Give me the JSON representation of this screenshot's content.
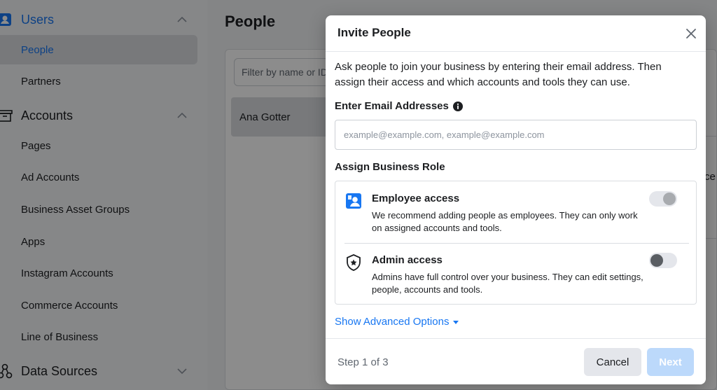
{
  "colors": {
    "accent": "#1877f2",
    "next_disabled": "#bcd9fb",
    "overlay": "rgba(0,0,0,0.45)"
  },
  "sidebar": {
    "sections": [
      {
        "label": "Users",
        "icon": "users-icon",
        "expanded": true,
        "active": true
      },
      {
        "label": "Accounts",
        "icon": "accounts-icon",
        "expanded": true,
        "active": false
      },
      {
        "label": "Data Sources",
        "icon": "data-sources-icon",
        "expanded": false,
        "active": false
      }
    ],
    "users_items": [
      {
        "label": "People",
        "selected": true
      },
      {
        "label": "Partners",
        "selected": false
      }
    ],
    "accounts_items": [
      {
        "label": "Pages"
      },
      {
        "label": "Ad Accounts"
      },
      {
        "label": "Business Asset Groups"
      },
      {
        "label": "Apps"
      },
      {
        "label": "Instagram Accounts"
      },
      {
        "label": "Commerce Accounts"
      },
      {
        "label": "Line of Business"
      }
    ]
  },
  "main": {
    "title": "People",
    "filter_placeholder": "Filter by name or ID",
    "person_name": "Ana Gotter",
    "right_fragment": "ce"
  },
  "modal": {
    "title": "Invite People",
    "close_icon": "close-icon",
    "intro": "Ask people to join your business by entering their email address. Then assign their access and which accounts and tools they can use.",
    "email_label": "Enter Email Addresses",
    "email_placeholder": "example@example.com, example@example.com",
    "email_value": "",
    "role_label": "Assign Business Role",
    "roles": [
      {
        "title": "Employee access",
        "desc": "We recommend adding people as employees. They can only work on assigned accounts and tools.",
        "icon": "employee-badge-icon",
        "enabled": true
      },
      {
        "title": "Admin access",
        "desc": "Admins have full control over your business. They can edit settings, people, accounts and tools.",
        "icon": "admin-shield-icon",
        "enabled": false
      }
    ],
    "advanced_label": "Show Advanced Options",
    "step": "Step 1 of 3",
    "cancel_label": "Cancel",
    "next_label": "Next"
  }
}
